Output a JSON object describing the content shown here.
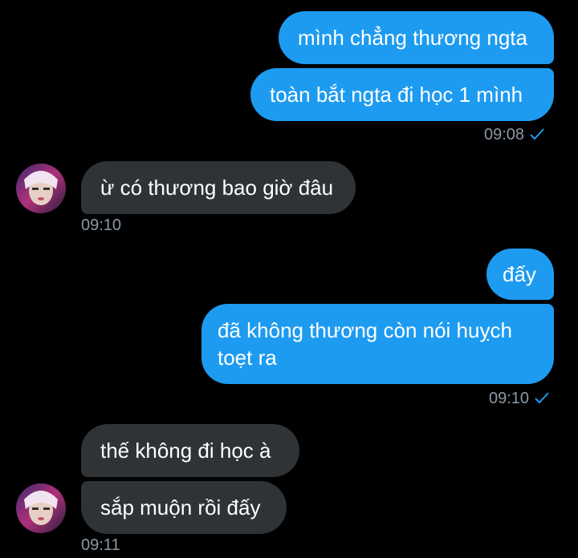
{
  "colors": {
    "background": "#000000",
    "outgoing_bubble": "#1d9bf0",
    "incoming_bubble": "#2f3336",
    "timestamp": "#8b98a5",
    "read_check": "#1d9bf0"
  },
  "messages": [
    {
      "direction": "out",
      "text": "mình chẳng thương ngta"
    },
    {
      "direction": "out",
      "text": "toàn bắt ngta đi học 1 mình"
    },
    {
      "direction": "in",
      "text": "ừ có thương bao giờ đâu"
    },
    {
      "direction": "out",
      "text": "đấy"
    },
    {
      "direction": "out",
      "text": "đã không thương còn nói huỵch toẹt ra"
    },
    {
      "direction": "in",
      "text": "thế không đi học à"
    },
    {
      "direction": "in",
      "text": "sắp muộn rồi đấy"
    }
  ],
  "timestamps": {
    "group1": "09:08",
    "group2": "09:10",
    "group3": "09:10",
    "group4": "09:11"
  },
  "icons": {
    "read_receipt": "check-icon",
    "avatar": "avatar-photo"
  }
}
